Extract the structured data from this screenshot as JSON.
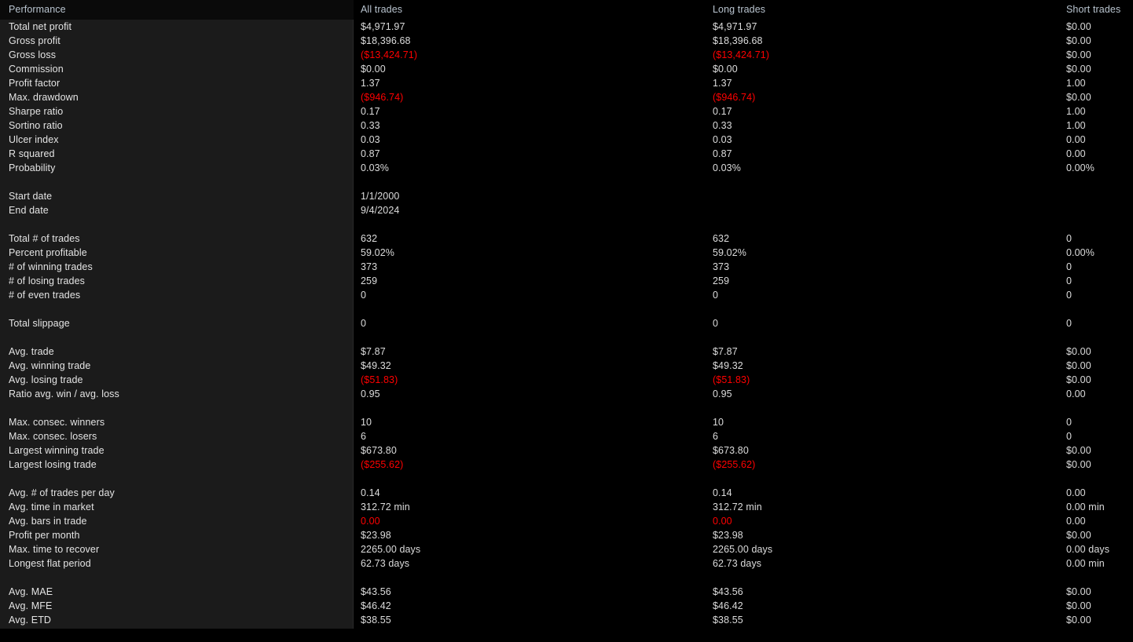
{
  "report": {
    "columns": {
      "label_header": "Performance",
      "all_header": "All trades",
      "long_header": "Long trades",
      "short_header": "Short trades"
    },
    "colors": {
      "negative": "#ff0000",
      "positive": "#dcdcdc",
      "header_text": "#b9c4cf",
      "label_panel_bg": "#1b1b1b",
      "page_bg": "#000000"
    },
    "groups": [
      {
        "name": "profitability",
        "rows": [
          {
            "label": "Total net profit",
            "all": "$4,971.97",
            "all_neg": false,
            "long": "$4,971.97",
            "long_neg": false,
            "short": "$0.00",
            "short_neg": false
          },
          {
            "label": "Gross profit",
            "all": "$18,396.68",
            "all_neg": false,
            "long": "$18,396.68",
            "long_neg": false,
            "short": "$0.00",
            "short_neg": false
          },
          {
            "label": "Gross loss",
            "all": "($13,424.71)",
            "all_neg": true,
            "long": "($13,424.71)",
            "long_neg": true,
            "short": "$0.00",
            "short_neg": false
          },
          {
            "label": "Commission",
            "all": "$0.00",
            "all_neg": false,
            "long": "$0.00",
            "long_neg": false,
            "short": "$0.00",
            "short_neg": false
          },
          {
            "label": "Profit factor",
            "all": "1.37",
            "all_neg": false,
            "long": "1.37",
            "long_neg": false,
            "short": "1.00",
            "short_neg": false
          },
          {
            "label": "Max. drawdown",
            "all": "($946.74)",
            "all_neg": true,
            "long": "($946.74)",
            "long_neg": true,
            "short": "$0.00",
            "short_neg": false
          },
          {
            "label": "Sharpe ratio",
            "all": "0.17",
            "all_neg": false,
            "long": "0.17",
            "long_neg": false,
            "short": "1.00",
            "short_neg": false
          },
          {
            "label": "Sortino ratio",
            "all": "0.33",
            "all_neg": false,
            "long": "0.33",
            "long_neg": false,
            "short": "1.00",
            "short_neg": false
          },
          {
            "label": "Ulcer index",
            "all": "0.03",
            "all_neg": false,
            "long": "0.03",
            "long_neg": false,
            "short": "0.00",
            "short_neg": false
          },
          {
            "label": "R squared",
            "all": "0.87",
            "all_neg": false,
            "long": "0.87",
            "long_neg": false,
            "short": "0.00",
            "short_neg": false
          },
          {
            "label": "Probability",
            "all": "0.03%",
            "all_neg": false,
            "long": "0.03%",
            "long_neg": false,
            "short": "0.00%",
            "short_neg": false
          }
        ]
      },
      {
        "name": "dates",
        "rows": [
          {
            "label": "Start date",
            "all": "1/1/2000",
            "all_neg": false,
            "long": "",
            "long_neg": false,
            "short": "",
            "short_neg": false
          },
          {
            "label": "End date",
            "all": "9/4/2024",
            "all_neg": false,
            "long": "",
            "long_neg": false,
            "short": "",
            "short_neg": false
          }
        ]
      },
      {
        "name": "trade-counts",
        "rows": [
          {
            "label": "Total # of trades",
            "all": "632",
            "all_neg": false,
            "long": "632",
            "long_neg": false,
            "short": "0",
            "short_neg": false
          },
          {
            "label": "Percent profitable",
            "all": "59.02%",
            "all_neg": false,
            "long": "59.02%",
            "long_neg": false,
            "short": "0.00%",
            "short_neg": false
          },
          {
            "label": "# of winning trades",
            "all": "373",
            "all_neg": false,
            "long": "373",
            "long_neg": false,
            "short": "0",
            "short_neg": false
          },
          {
            "label": "# of losing trades",
            "all": "259",
            "all_neg": false,
            "long": "259",
            "long_neg": false,
            "short": "0",
            "short_neg": false
          },
          {
            "label": "# of even trades",
            "all": "0",
            "all_neg": false,
            "long": "0",
            "long_neg": false,
            "short": "0",
            "short_neg": false
          }
        ]
      },
      {
        "name": "slippage",
        "rows": [
          {
            "label": "Total slippage",
            "all": "0",
            "all_neg": false,
            "long": "0",
            "long_neg": false,
            "short": "0",
            "short_neg": false
          }
        ]
      },
      {
        "name": "averages",
        "rows": [
          {
            "label": "Avg. trade",
            "all": "$7.87",
            "all_neg": false,
            "long": "$7.87",
            "long_neg": false,
            "short": "$0.00",
            "short_neg": false
          },
          {
            "label": "Avg. winning trade",
            "all": "$49.32",
            "all_neg": false,
            "long": "$49.32",
            "long_neg": false,
            "short": "$0.00",
            "short_neg": false
          },
          {
            "label": "Avg. losing trade",
            "all": "($51.83)",
            "all_neg": true,
            "long": "($51.83)",
            "long_neg": true,
            "short": "$0.00",
            "short_neg": false
          },
          {
            "label": "Ratio avg. win / avg. loss",
            "all": "0.95",
            "all_neg": false,
            "long": "0.95",
            "long_neg": false,
            "short": "0.00",
            "short_neg": false
          }
        ]
      },
      {
        "name": "streaks",
        "rows": [
          {
            "label": "Max. consec. winners",
            "all": "10",
            "all_neg": false,
            "long": "10",
            "long_neg": false,
            "short": "0",
            "short_neg": false
          },
          {
            "label": "Max. consec. losers",
            "all": "6",
            "all_neg": false,
            "long": "6",
            "long_neg": false,
            "short": "0",
            "short_neg": false
          },
          {
            "label": "Largest winning trade",
            "all": "$673.80",
            "all_neg": false,
            "long": "$673.80",
            "long_neg": false,
            "short": "$0.00",
            "short_neg": false
          },
          {
            "label": "Largest losing trade",
            "all": "($255.62)",
            "all_neg": true,
            "long": "($255.62)",
            "long_neg": true,
            "short": "$0.00",
            "short_neg": false
          }
        ]
      },
      {
        "name": "timing",
        "rows": [
          {
            "label": "Avg. # of trades per day",
            "all": "0.14",
            "all_neg": false,
            "long": "0.14",
            "long_neg": false,
            "short": "0.00",
            "short_neg": false
          },
          {
            "label": "Avg. time in market",
            "all": "312.72 min",
            "all_neg": false,
            "long": "312.72 min",
            "long_neg": false,
            "short": "0.00 min",
            "short_neg": false
          },
          {
            "label": "Avg. bars in trade",
            "all": "0.00",
            "all_neg": true,
            "long": "0.00",
            "long_neg": true,
            "short": "0.00",
            "short_neg": false
          },
          {
            "label": "Profit per month",
            "all": "$23.98",
            "all_neg": false,
            "long": "$23.98",
            "long_neg": false,
            "short": "$0.00",
            "short_neg": false
          },
          {
            "label": "Max. time to recover",
            "all": "2265.00 days",
            "all_neg": false,
            "long": "2265.00 days",
            "long_neg": false,
            "short": "0.00 days",
            "short_neg": false
          },
          {
            "label": "Longest flat period",
            "all": "62.73 days",
            "all_neg": false,
            "long": "62.73 days",
            "long_neg": false,
            "short": "0.00 min",
            "short_neg": false
          }
        ]
      },
      {
        "name": "excursions",
        "rows": [
          {
            "label": "Avg. MAE",
            "all": "$43.56",
            "all_neg": false,
            "long": "$43.56",
            "long_neg": false,
            "short": "$0.00",
            "short_neg": false
          },
          {
            "label": "Avg. MFE",
            "all": "$46.42",
            "all_neg": false,
            "long": "$46.42",
            "long_neg": false,
            "short": "$0.00",
            "short_neg": false
          },
          {
            "label": "Avg. ETD",
            "all": "$38.55",
            "all_neg": false,
            "long": "$38.55",
            "long_neg": false,
            "short": "$0.00",
            "short_neg": false
          }
        ]
      }
    ]
  }
}
